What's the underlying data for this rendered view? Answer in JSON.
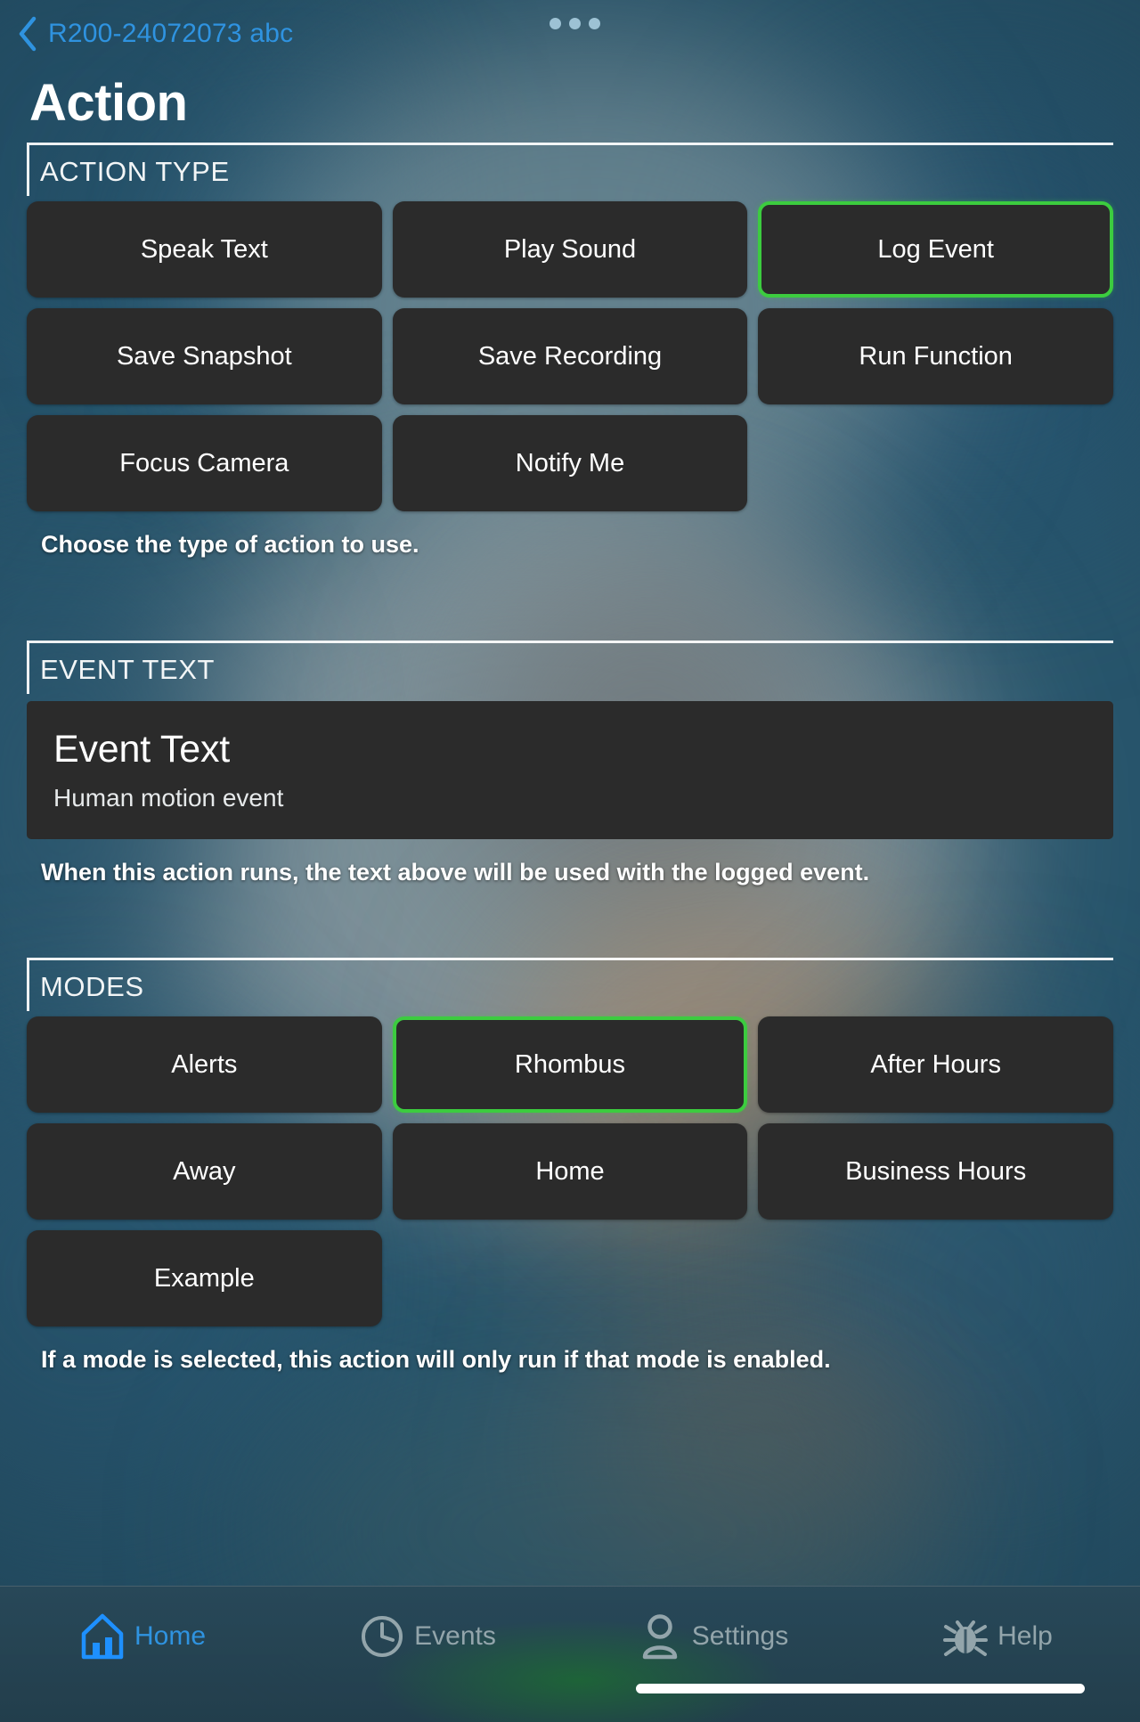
{
  "header": {
    "back_label": "R200-24072073 abc",
    "back_icon": "chevron-left-icon",
    "menu_icon": "three-dots-icon",
    "page_title": "Action"
  },
  "colors": {
    "accent_blue": "#2f93e0",
    "selected_green": "#3ccc3f",
    "tile_bg": "#2b2b2b",
    "background_blue": "#27546b"
  },
  "sections": [
    {
      "id": "action-type",
      "title": "ACTION TYPE",
      "helper": "Choose the type of action to use.",
      "options": [
        {
          "label": "Speak Text",
          "selected": false
        },
        {
          "label": "Play Sound",
          "selected": false
        },
        {
          "label": "Log Event",
          "selected": true
        },
        {
          "label": "Save Snapshot",
          "selected": false
        },
        {
          "label": "Save Recording",
          "selected": false
        },
        {
          "label": "Run Function",
          "selected": false
        },
        {
          "label": "Focus Camera",
          "selected": false
        },
        {
          "label": "Notify Me",
          "selected": false
        }
      ]
    },
    {
      "id": "event-text",
      "title": "EVENT TEXT",
      "helper": "When this action runs, the text above will be used with the logged event.",
      "card": {
        "label": "Event Text",
        "value": "Human motion event"
      }
    },
    {
      "id": "modes",
      "title": "MODES",
      "helper": "If a mode is selected, this action will only run if that mode is enabled.",
      "options": [
        {
          "label": "Alerts",
          "selected": false
        },
        {
          "label": "Rhombus",
          "selected": true
        },
        {
          "label": "After Hours",
          "selected": false
        },
        {
          "label": "Away",
          "selected": false
        },
        {
          "label": "Home",
          "selected": false
        },
        {
          "label": "Business Hours",
          "selected": false
        },
        {
          "label": "Example",
          "selected": false
        }
      ]
    }
  ],
  "tabbar": {
    "items": [
      {
        "label": "Home",
        "icon": "home-icon",
        "active": true
      },
      {
        "label": "Events",
        "icon": "clock-icon",
        "active": false
      },
      {
        "label": "Settings",
        "icon": "person-icon",
        "active": false
      },
      {
        "label": "Help",
        "icon": "bug-icon",
        "active": false
      }
    ]
  }
}
